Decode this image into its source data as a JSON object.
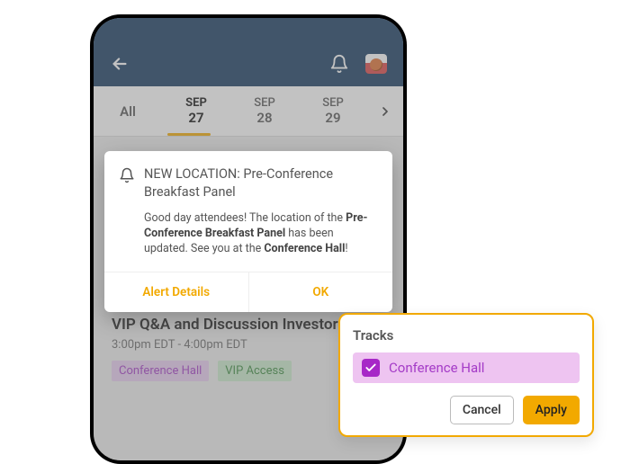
{
  "header": {
    "back_icon": "back",
    "bell_icon": "notifications",
    "avatar": "basketball"
  },
  "tabs": {
    "all": "All",
    "items": [
      {
        "month": "SEP",
        "day": "27",
        "active": true
      },
      {
        "month": "SEP",
        "day": "28",
        "active": false
      },
      {
        "month": "SEP",
        "day": "29",
        "active": false
      }
    ],
    "active_index": 0
  },
  "schedule": {
    "time_label": "3:00pm EDT",
    "session": {
      "title": "VIP Q&A and Discussion Investors",
      "time": "3:00pm EDT - 4:00pm EDT",
      "tags": [
        {
          "label": "Conference Hall",
          "variant": "purple"
        },
        {
          "label": "VIP Access",
          "variant": "green"
        }
      ]
    }
  },
  "alert": {
    "title": "NEW LOCATION: Pre-Conference Breakfast Panel",
    "body_pre": "Good day attendees! The location of the ",
    "body_bold1": "Pre-Conference Breakfast Panel",
    "body_mid": " has been updated. See you at the ",
    "body_bold2": "Conference Hall",
    "body_suffix": "!",
    "actions": {
      "details": "Alert Details",
      "ok": "OK"
    }
  },
  "tracks_popover": {
    "title": "Tracks",
    "item": {
      "label": "Conference Hall",
      "checked": true
    },
    "cancel": "Cancel",
    "apply": "Apply"
  },
  "colors": {
    "brand_blue": "#14395f",
    "accent": "#f2a900",
    "purple": "#a43bc7"
  }
}
